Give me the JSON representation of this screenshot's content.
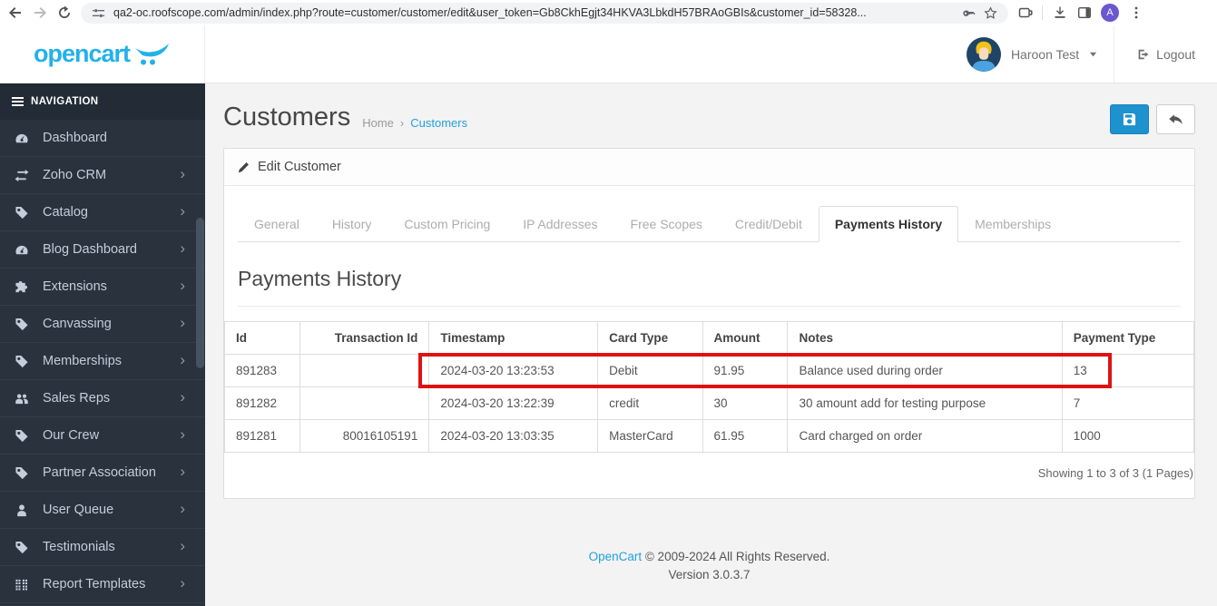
{
  "browser": {
    "url": "qa2-oc.roofscope.com/admin/index.php?route=customer/customer/edit&user_token=Gb8CkhEgjt34HKVA3LbkdH57BRAoGBIs&customer_id=58328...",
    "profile_initial": "A"
  },
  "header": {
    "logo": "opencart",
    "user_name": "Haroon Test",
    "logout": "Logout"
  },
  "sidebar": {
    "title": "NAVIGATION",
    "chevron": "›",
    "items": [
      {
        "label": "Dashboard",
        "icon": "gauge",
        "has_children": false
      },
      {
        "label": "Zoho CRM",
        "icon": "exchange",
        "has_children": true
      },
      {
        "label": "Catalog",
        "icon": "tag",
        "has_children": true
      },
      {
        "label": "Blog Dashboard",
        "icon": "gauge",
        "has_children": true
      },
      {
        "label": "Extensions",
        "icon": "puzzle",
        "has_children": true
      },
      {
        "label": "Canvassing",
        "icon": "tag",
        "has_children": true
      },
      {
        "label": "Memberships",
        "icon": "tag",
        "has_children": true
      },
      {
        "label": "Sales Reps",
        "icon": "users",
        "has_children": true
      },
      {
        "label": "Our Crew",
        "icon": "tag",
        "has_children": true
      },
      {
        "label": "Partner Association",
        "icon": "tag",
        "has_children": true
      },
      {
        "label": "User Queue",
        "icon": "user",
        "has_children": true
      },
      {
        "label": "Testimonials",
        "icon": "tag",
        "has_children": true
      },
      {
        "label": "Report Templates",
        "icon": "grid",
        "has_children": true
      }
    ]
  },
  "page": {
    "title": "Customers",
    "breadcrumb_home": "Home",
    "breadcrumb_separator": "›",
    "breadcrumb_current": "Customers"
  },
  "panel": {
    "heading": "Edit Customer",
    "tabs": [
      "General",
      "History",
      "Custom Pricing",
      "IP Addresses",
      "Free Scopes",
      "Credit/Debit",
      "Payments History",
      "Memberships"
    ],
    "active_tab_index": 6,
    "section_title": "Payments History",
    "table": {
      "columns": [
        "Id",
        "Transaction Id",
        "Timestamp",
        "Card Type",
        "Amount",
        "Notes",
        "Payment Type"
      ],
      "rows": [
        [
          "891283",
          "",
          "2024-03-20 13:23:53",
          "Debit",
          "91.95",
          "Balance used during order",
          "13"
        ],
        [
          "891282",
          "",
          "2024-03-20 13:22:39",
          "credit",
          "30",
          "30 amount add for testing purpose",
          "7"
        ],
        [
          "891281",
          "80016105191",
          "2024-03-20 13:03:35",
          "MasterCard",
          "61.95",
          "Card charged on order",
          "1000"
        ]
      ],
      "highlighted_row_index": 0
    },
    "pagination": "Showing 1 to 3 of 3 (1 Pages)"
  },
  "footer": {
    "link": "OpenCart",
    "copyright": " © 2009-2024 All Rights Reserved.",
    "version": "Version 3.0.3.7"
  },
  "colors": {
    "accent_blue": "#1e91cf",
    "link_blue": "#23a1de",
    "logo_blue": "#23b1ea",
    "highlight_red": "#df1212",
    "sidebar_bg": "#2a323e"
  }
}
